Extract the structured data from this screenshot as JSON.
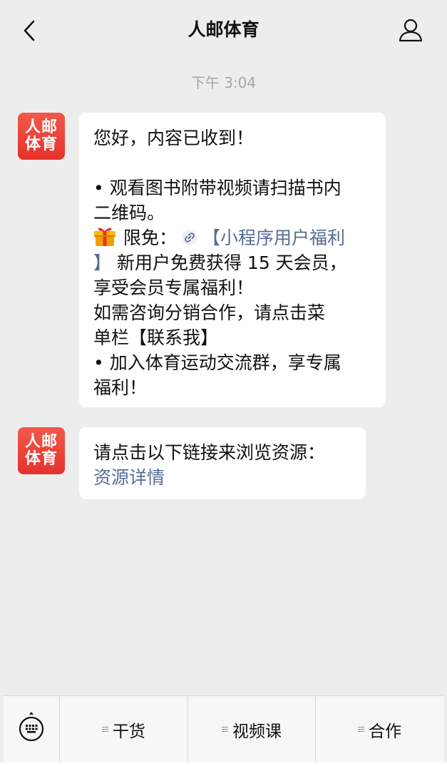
{
  "header": {
    "title": "人邮体育",
    "back_icon": "chevron-left-icon",
    "profile_icon": "person-outline-icon"
  },
  "timestamp": "下午 3:04",
  "avatar": {
    "line1": "人邮",
    "line2": "体育",
    "color": "#e5322b"
  },
  "message1": {
    "greeting": "您好，内容已收到！",
    "line_video_1": "• 观看图书附带视频请扫描书内",
    "line_video_2": "二维码。",
    "gift_icon": "gift-icon",
    "free_label": "限免：",
    "link_icon": "mini-program-link-icon",
    "link_part1": "【小程序用户福利",
    "link_part2": "】",
    "benefit_1": " 新用户免费获得 15 天会员，",
    "benefit_2": "享受会员专属福利！",
    "consult_1": "如需咨询分销合作，请点击菜",
    "consult_2": "单栏【联系我】",
    "group_1": "• 加入体育运动交流群，享专属",
    "group_2": "福利！"
  },
  "message2": {
    "text": "请点击以下链接来浏览资源：",
    "link": "资源详情"
  },
  "bottom_menu": {
    "keyboard_icon": "keyboard-icon",
    "items": [
      {
        "label": "干货"
      },
      {
        "label": "视频课"
      },
      {
        "label": "合作"
      }
    ]
  },
  "colors": {
    "background": "#ededed",
    "bubble": "#ffffff",
    "link": "#576b95",
    "timestamp": "#a5a5a5"
  }
}
